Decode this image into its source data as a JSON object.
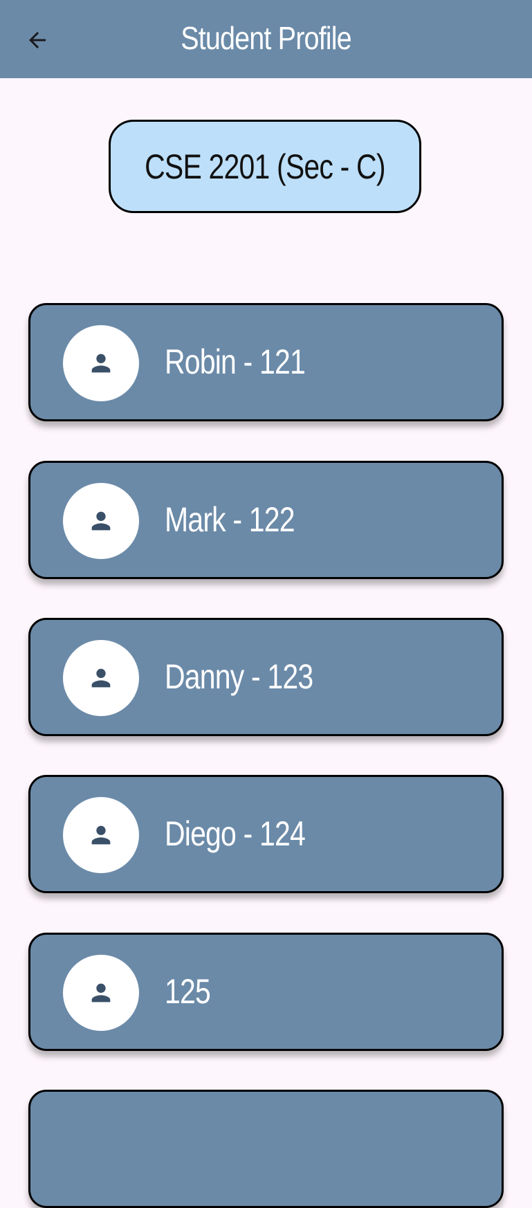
{
  "header": {
    "title": "Student Profile",
    "back_icon": "arrow-left-icon"
  },
  "course": {
    "label": "CSE 2201 (Sec - C)"
  },
  "students": [
    {
      "label": "Robin - 121",
      "icon": "person-icon"
    },
    {
      "label": "Mark - 122",
      "icon": "person-icon"
    },
    {
      "label": "Danny - 123",
      "icon": "person-icon"
    },
    {
      "label": "Diego - 124",
      "icon": "person-icon"
    },
    {
      "label": "125",
      "icon": "person-icon"
    },
    {
      "label": "",
      "icon": ""
    }
  ],
  "colors": {
    "appbar": "#6b8aa8",
    "background": "#fdf6fc",
    "chip": "#bddff9",
    "card": "#6b8aa8",
    "avatar_icon": "#3a5068"
  }
}
